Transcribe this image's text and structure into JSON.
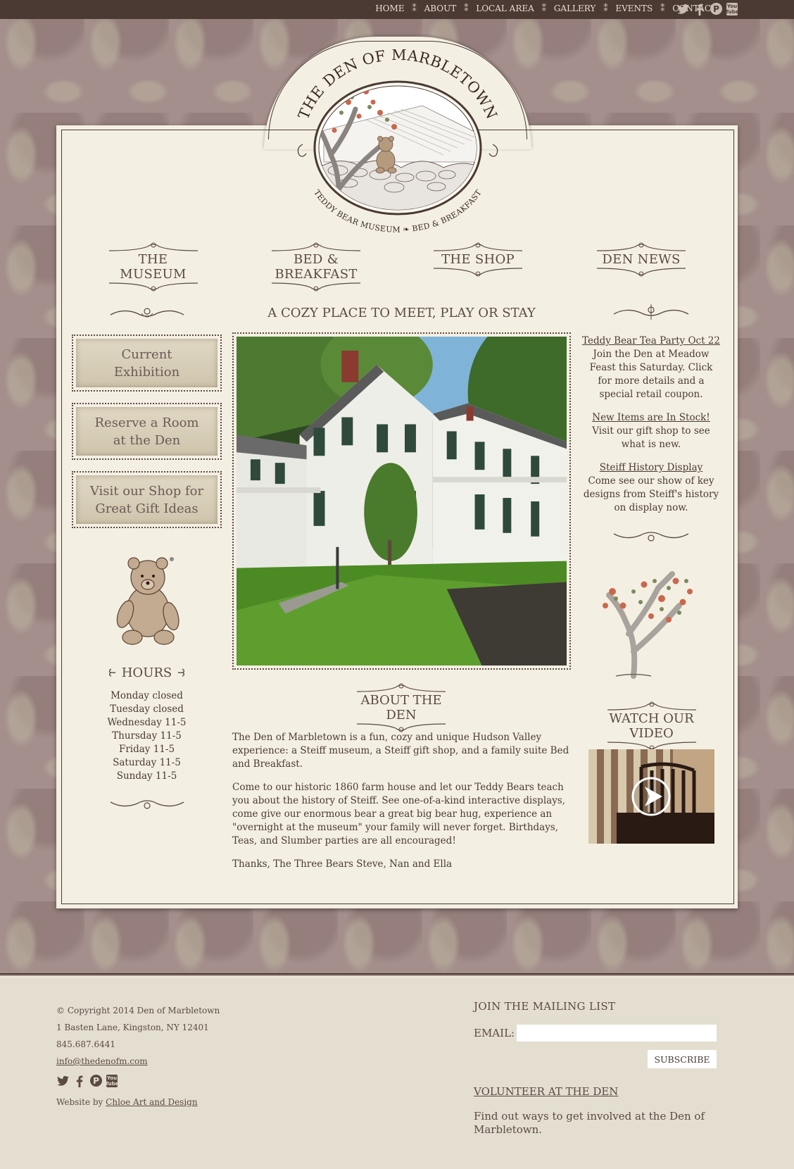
{
  "nav": {
    "items": [
      "HOME",
      "ABOUT",
      "LOCAL AREA",
      "GALLERY",
      "EVENTS",
      "CONTACT"
    ],
    "separator": "⁑",
    "social": [
      "twitter-icon",
      "facebook-icon",
      "pinterest-icon",
      "youtube-icon"
    ]
  },
  "logo": {
    "title": "THE DEN OF MARBLETOWN",
    "subtitle": "TEDDY BEAR MUSEUM ❧ BED & BREAKFAST"
  },
  "tabs": [
    "THE MUSEUM",
    "BED & BREAKFAST",
    "THE SHOP",
    "DEN NEWS"
  ],
  "main": {
    "tagline": "A COZY PLACE TO MEET, PLAY OR STAY",
    "about_title": "ABOUT THE DEN",
    "about_paragraphs": [
      "The Den of Marbletown is a fun, cozy and unique Hudson Valley experience: a Steiff museum, a Steiff gift shop, and a family suite Bed and Breakfast.",
      "Come to our historic 1860 farm house and let our Teddy Bears teach you about the history of Steiff. See one-of-a-kind interactive displays, come give our enormous bear a great big bear hug, experience an \"overnight at the museum\" your family will never forget. Birthdays, Teas, and Slumber parties are all encouraged!",
      "Thanks, The Three Bears Steve, Nan and Ella"
    ]
  },
  "left": {
    "buttons": [
      {
        "line1": "Current",
        "line2": "Exhibition"
      },
      {
        "line1": "Reserve a Room",
        "line2": "at the Den"
      },
      {
        "line1": "Visit our Shop for",
        "line2": "Great Gift Ideas"
      }
    ],
    "hours_title": "HOURS",
    "hours": [
      "Monday closed",
      "Tuesday closed",
      "Wednesday 11-5",
      "Thursday 11-5",
      "Friday 11-5",
      "Saturday 11-5",
      "Sunday 11-5"
    ]
  },
  "news": [
    {
      "title": "Teddy Bear Tea Party Oct 22",
      "text": "Join the Den at Meadow Feast this Saturday. Click for more details and a special retail coupon."
    },
    {
      "title": "New Items are In Stock!",
      "text": "Visit our gift shop to see what is new."
    },
    {
      "title": "Steiff History Display",
      "text": "Come see our show of key designs from Steiff's history on display now."
    }
  ],
  "video_title": "WATCH OUR VIDEO",
  "footer": {
    "copyright": "© Copyright 2014 Den of Marbletown",
    "address": "1 Basten Lane, Kingston, NY 12401",
    "phone": "845.687.6441",
    "email": "info@thedenofm.com",
    "credit_prefix": "Website by ",
    "credit_link": "Chloe Art and Design",
    "mailing_title": "JOIN THE MAILING LIST",
    "email_label": "EMAIL:",
    "email_value": "",
    "subscribe": "SUBSCRIBE",
    "volunteer_title": "VOLUNTEER AT THE DEN",
    "volunteer_text": "Find out ways to get involved at the Den of Marbletown."
  },
  "colors": {
    "topbar": "#4a3a33",
    "panel": "#f4efe3",
    "background": "#a48f8c",
    "footer": "#e4ded0",
    "text": "#5a4a44"
  }
}
